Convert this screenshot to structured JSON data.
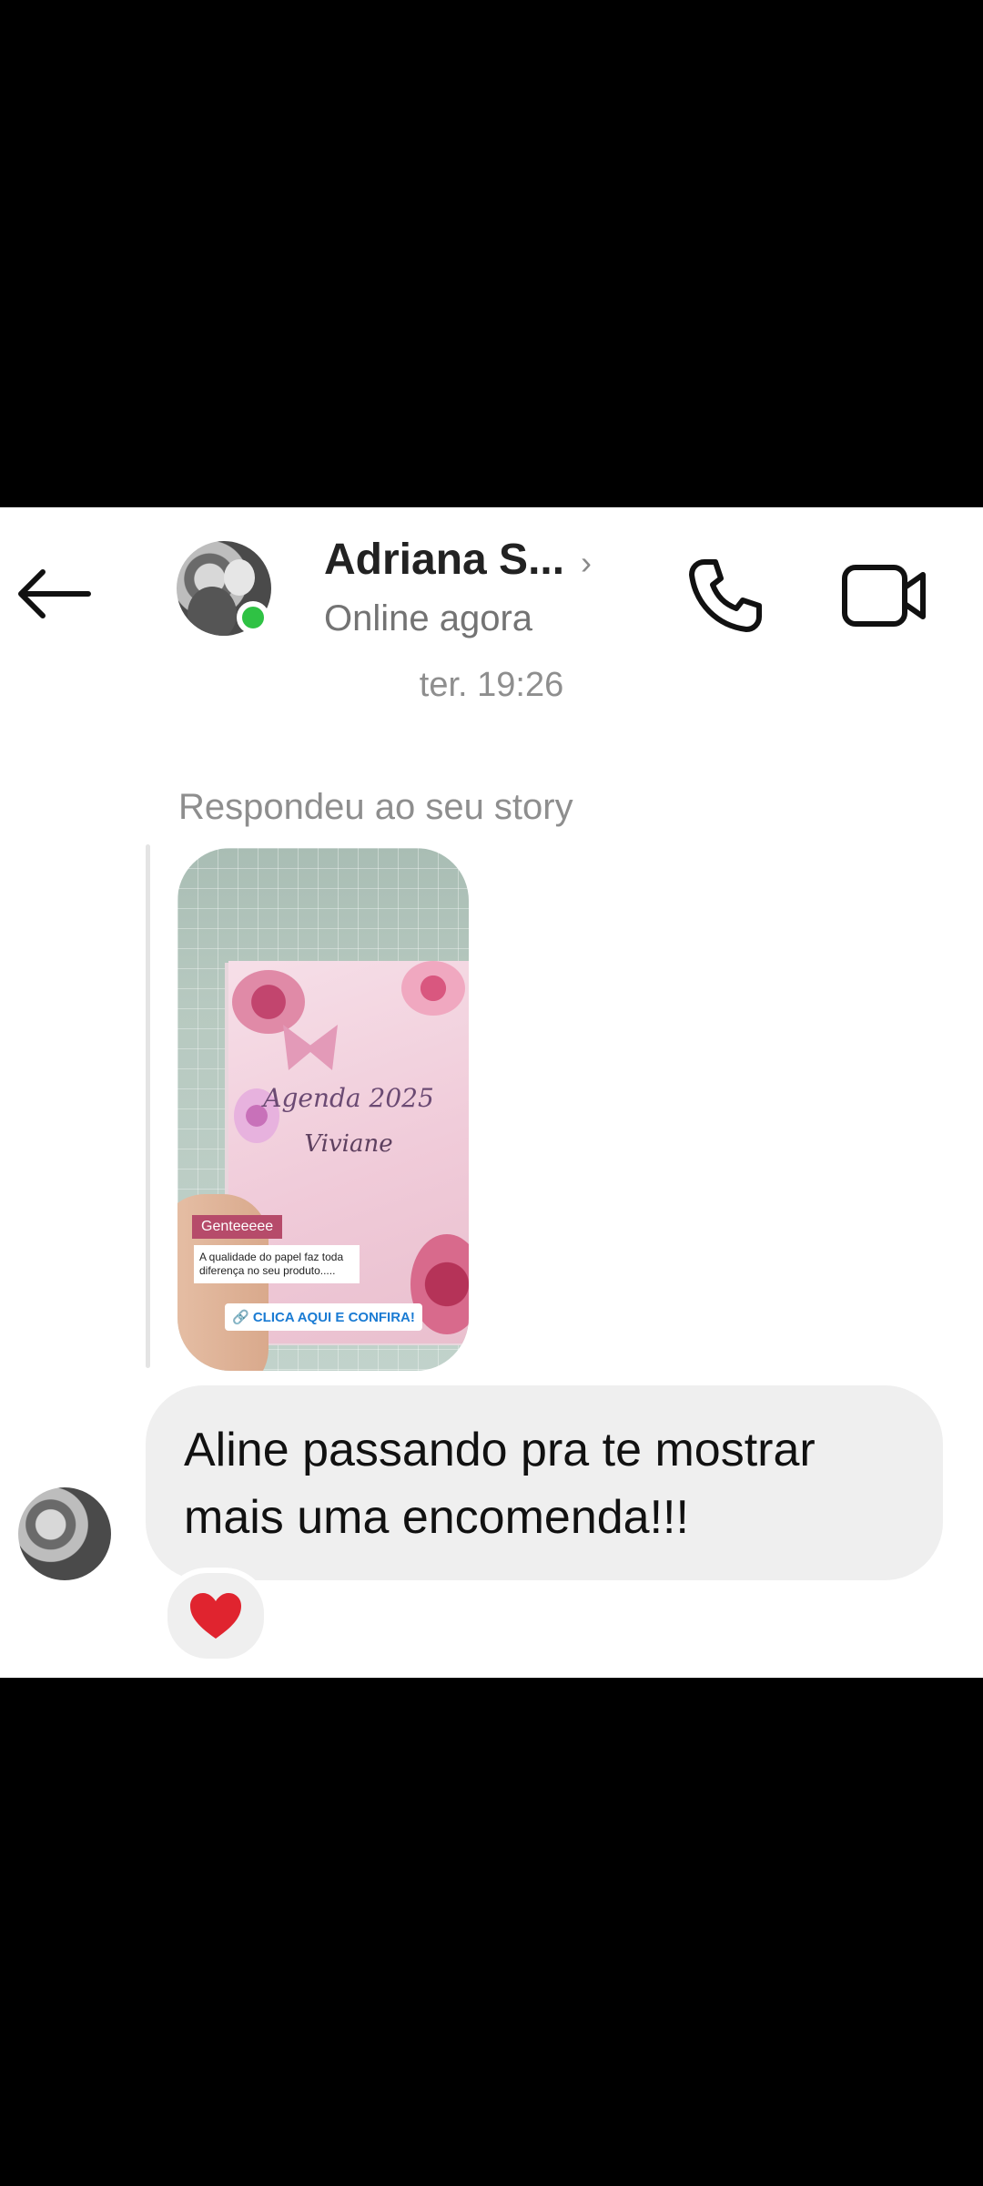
{
  "header": {
    "contact_name": "Adriana S...",
    "status": "Online agora",
    "chevron": "›",
    "icons": [
      "back-arrow-icon",
      "phone-icon",
      "video-camera-icon",
      "chevron-right-icon"
    ]
  },
  "conversation": {
    "timestamp": "ter. 19:26",
    "story_reply_label": "Respondeu ao seu story",
    "story": {
      "book_title": "Agenda 2025",
      "book_name": "Viviane",
      "tag": "Genteeeee",
      "caption": "A qualidade do papel faz toda diferença no seu produto.....",
      "link": "🔗 CLICA AQUI E CONFIRA!"
    },
    "message": {
      "text": "Aline passando pra te mostrar mais uma encomenda!!!",
      "reaction": "❤️"
    }
  },
  "colors": {
    "online": "#2fc244",
    "bubble": "#efefef",
    "muted_text": "#8e8e8e",
    "heart": "#e0242f"
  }
}
